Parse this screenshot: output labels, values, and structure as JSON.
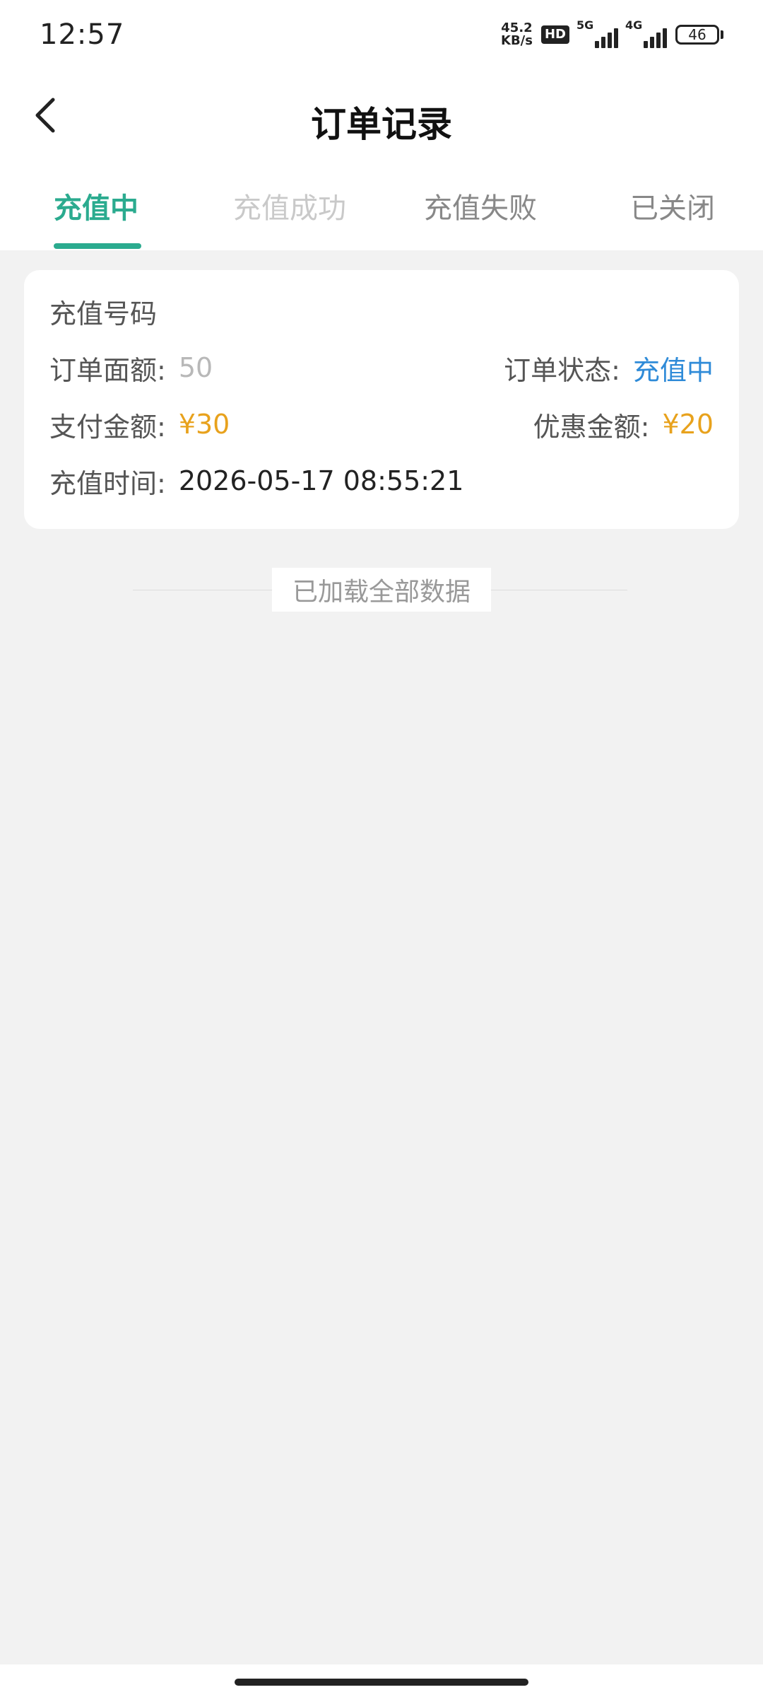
{
  "status_bar": {
    "time": "12:57",
    "net_speed_value": "45.2",
    "net_speed_unit": "KB/s",
    "hd_label": "HD",
    "signal_1_label": "5G",
    "signal_2_label": "4G",
    "battery_level": "46"
  },
  "header": {
    "title": "订单记录",
    "back_icon": "chevron-left-icon"
  },
  "tabs": [
    {
      "label": "充值中",
      "active": true
    },
    {
      "label": "充值成功",
      "active": false
    },
    {
      "label": "充值失败",
      "active": false
    },
    {
      "label": "已关闭",
      "active": false
    }
  ],
  "order": {
    "recharge_number_label": "充值号码",
    "face_value_label": "订单面额:",
    "face_value": "50",
    "status_label": "订单状态:",
    "status": "充值中",
    "paid_label": "支付金额:",
    "paid": "¥30",
    "discount_label": "优惠金额:",
    "discount": "¥20",
    "time_label": "充值时间:",
    "time": "2026-05-17 08:55:21"
  },
  "footer": {
    "end_note": "已加载全部数据"
  },
  "colors": {
    "accent_green": "#2bab8f",
    "status_blue": "#2f8bd8",
    "amount_orange": "#e8a21d"
  }
}
